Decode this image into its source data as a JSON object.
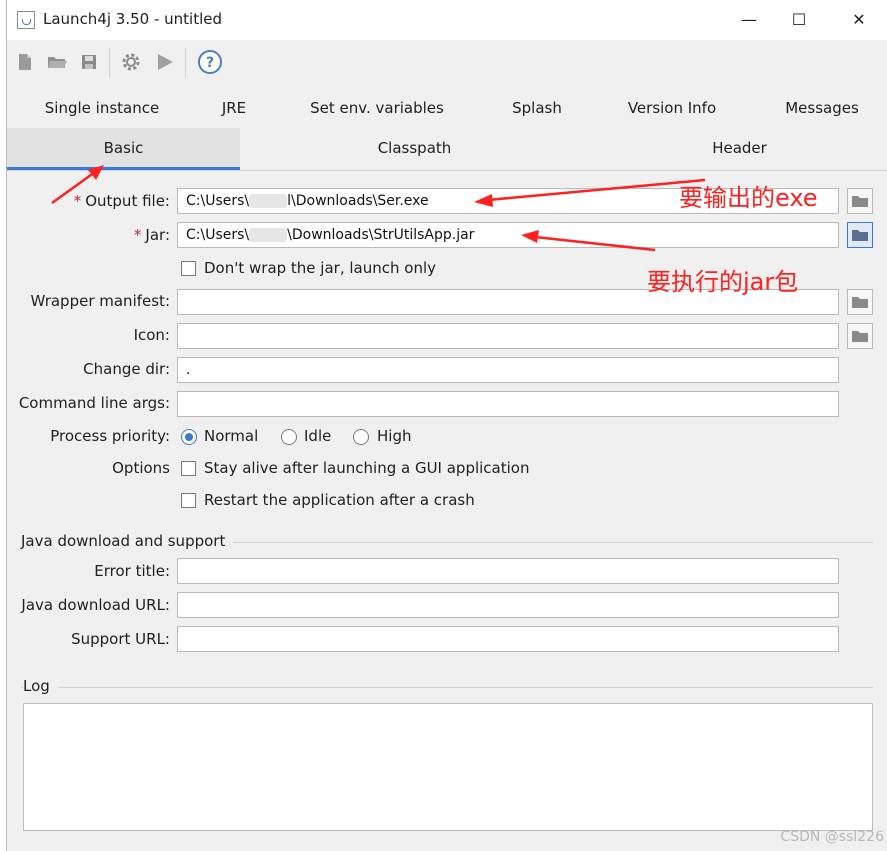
{
  "window": {
    "title": "Launch4j 3.50 - untitled",
    "controls": {
      "minimize": "—",
      "maximize": "☐",
      "close": "✕"
    }
  },
  "toolbar": {
    "buttons": [
      "new-file-icon",
      "open-folder-icon",
      "save-icon",
      "gear-icon",
      "play-icon",
      "help-icon"
    ]
  },
  "tabs": {
    "row1": [
      "Single instance",
      "JRE",
      "Set env. variables",
      "Splash",
      "Version Info",
      "Messages"
    ],
    "row2": [
      "Basic",
      "Classpath",
      "Header"
    ],
    "active": "Basic"
  },
  "basic": {
    "output_file": {
      "label": "Output file:",
      "required": "*",
      "value_prefix": "C:\\Users\\",
      "value_suffix": "l\\Downloads\\Ser.exe"
    },
    "jar": {
      "label": "Jar:",
      "required": "*",
      "value_prefix": "C:\\Users\\",
      "value_suffix": "\\Downloads\\StrUtilsApp.jar"
    },
    "dont_wrap": "Don't wrap the jar, launch only",
    "wrapper_manifest": {
      "label": "Wrapper manifest:",
      "value": ""
    },
    "icon": {
      "label": "Icon:",
      "value": ""
    },
    "change_dir": {
      "label": "Change dir:",
      "value": "."
    },
    "cmd_args": {
      "label": "Command line args:",
      "value": ""
    },
    "priority": {
      "label": "Process priority:",
      "options": [
        "Normal",
        "Idle",
        "High"
      ],
      "selected": "Normal"
    },
    "options": {
      "label": "Options",
      "stay_alive": "Stay alive after launching a GUI application",
      "restart": "Restart the application after a crash"
    }
  },
  "java_download": {
    "section": "Java download and support",
    "error_title": {
      "label": "Error title:",
      "value": ""
    },
    "download_url": {
      "label": "Java download URL:",
      "value": ""
    },
    "support_url": {
      "label": "Support URL:",
      "value": ""
    }
  },
  "log": {
    "section": "Log"
  },
  "annotations": {
    "output_note": "要输出的exe",
    "jar_note": "要执行的jar包",
    "color": "#ff2020"
  },
  "watermark": "CSDN @ssl226"
}
